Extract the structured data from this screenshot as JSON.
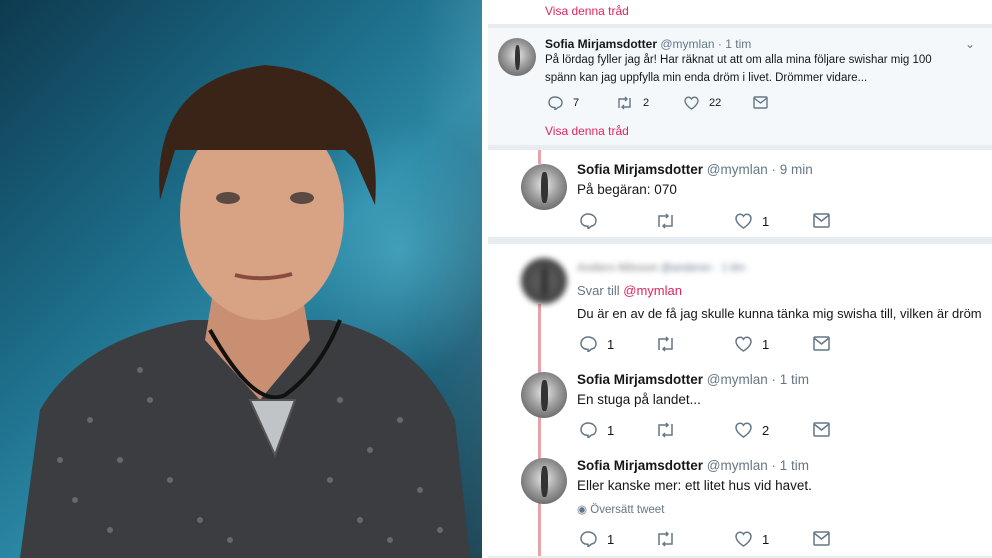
{
  "photo": {
    "alt": ""
  },
  "tweets": [
    {
      "id": "t1",
      "show_thread": "Visa denna tråd"
    },
    {
      "id": "t2",
      "name": "Sofia Mirjamsdotter",
      "handle": "@mymlan",
      "time": "· 1 tim",
      "line1": "På lördag fyller jag år! Har räknat ut att om alla mina följare swishar mig 100",
      "line2": "spänn kan jag uppfylla min enda dröm i livet. Drömmer vidare...",
      "replies": "7",
      "retweets": "2",
      "likes": "22",
      "show_thread": "Visa denna tråd"
    },
    {
      "id": "t3",
      "name": "Sofia Mirjamsdotter",
      "handle": "@mymlan",
      "time": "· 9 min",
      "text": "På begäran: 070",
      "replies": "",
      "retweets": "",
      "likes": "1"
    },
    {
      "id": "t4",
      "name": "Anders Nilsson",
      "handle": "@andersn",
      "time": "· 1 tim",
      "reply_prefix": "Svar till",
      "reply_to": "@mymlan",
      "text": "Du är en av de få jag skulle kunna tänka mig swisha till, vilken är dröm",
      "replies": "1",
      "retweets": "",
      "likes": "1"
    },
    {
      "id": "t5",
      "name": "Sofia Mirjamsdotter",
      "handle": "@mymlan",
      "time": "· 1 tim",
      "text": "En stuga på landet...",
      "replies": "1",
      "retweets": "",
      "likes": "2"
    },
    {
      "id": "t6",
      "name": "Sofia Mirjamsdotter",
      "handle": "@mymlan",
      "time": "· 1 tim",
      "text": "Eller kanske mer: ett litet hus vid havet.",
      "translate": "Översätt tweet",
      "replies": "1",
      "retweets": "",
      "likes": "1"
    }
  ],
  "colors": {
    "link": "#e0245e",
    "thread": "#e8a3a8",
    "muted": "#657786"
  }
}
